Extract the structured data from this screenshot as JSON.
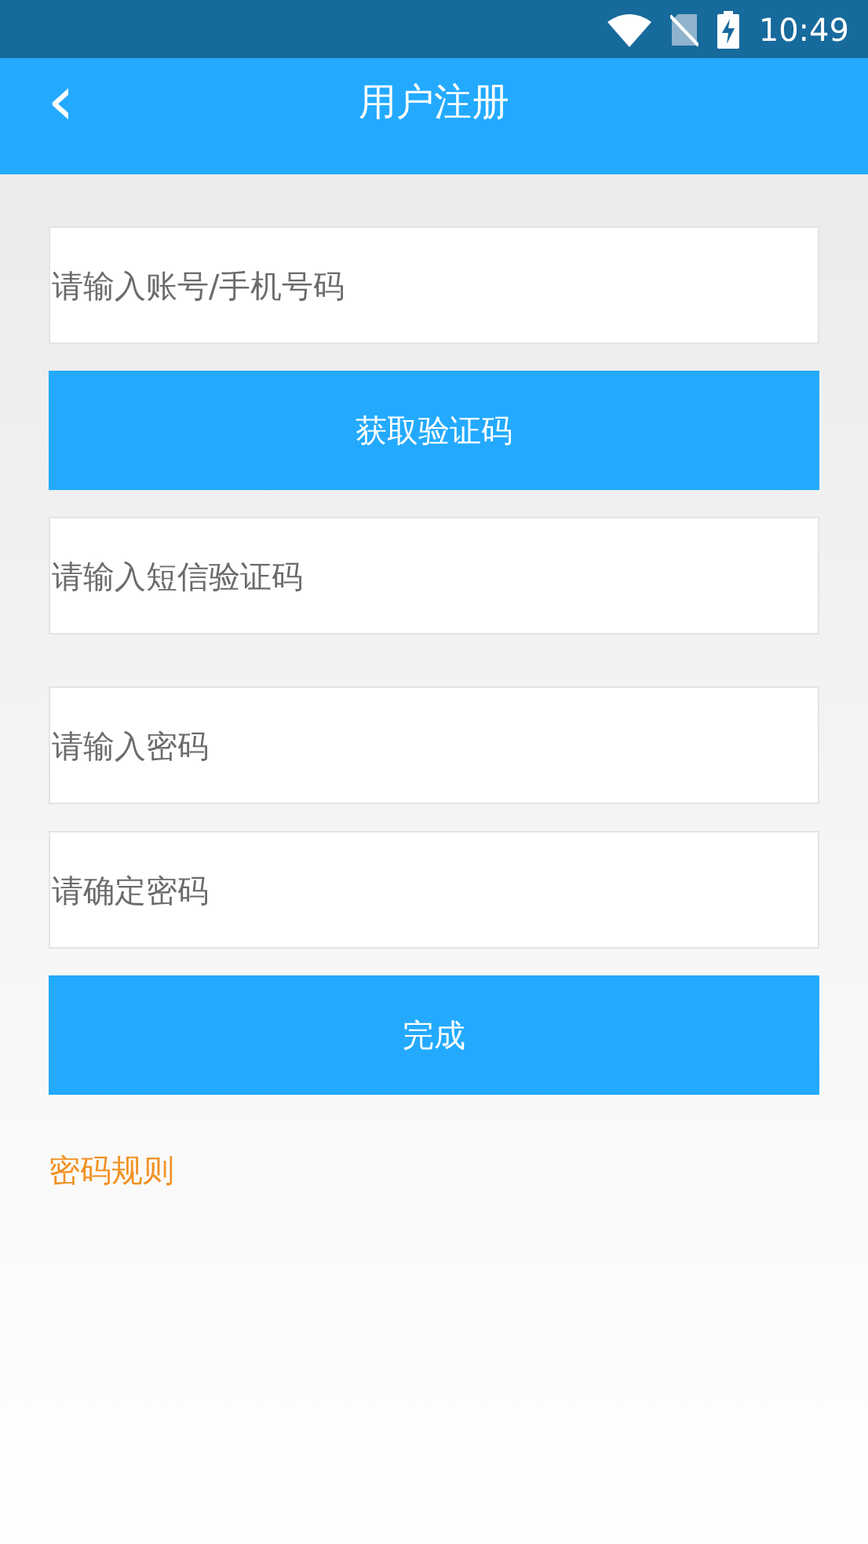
{
  "status_bar": {
    "time": "10:49"
  },
  "header": {
    "back": "‹",
    "title": "用户注册"
  },
  "items": [
    {
      "kind": "field",
      "placeholder": "请输入账号/手机号码"
    },
    {
      "kind": "button",
      "label": "获取验证码"
    },
    {
      "kind": "field",
      "placeholder": "请输入短信验证码"
    },
    {
      "kind": "spacer"
    },
    {
      "kind": "field",
      "placeholder": "请输入密码"
    },
    {
      "kind": "field",
      "placeholder": "请确定密码"
    },
    {
      "kind": "button",
      "label": "完成"
    }
  ],
  "rules_link": "密码规则"
}
